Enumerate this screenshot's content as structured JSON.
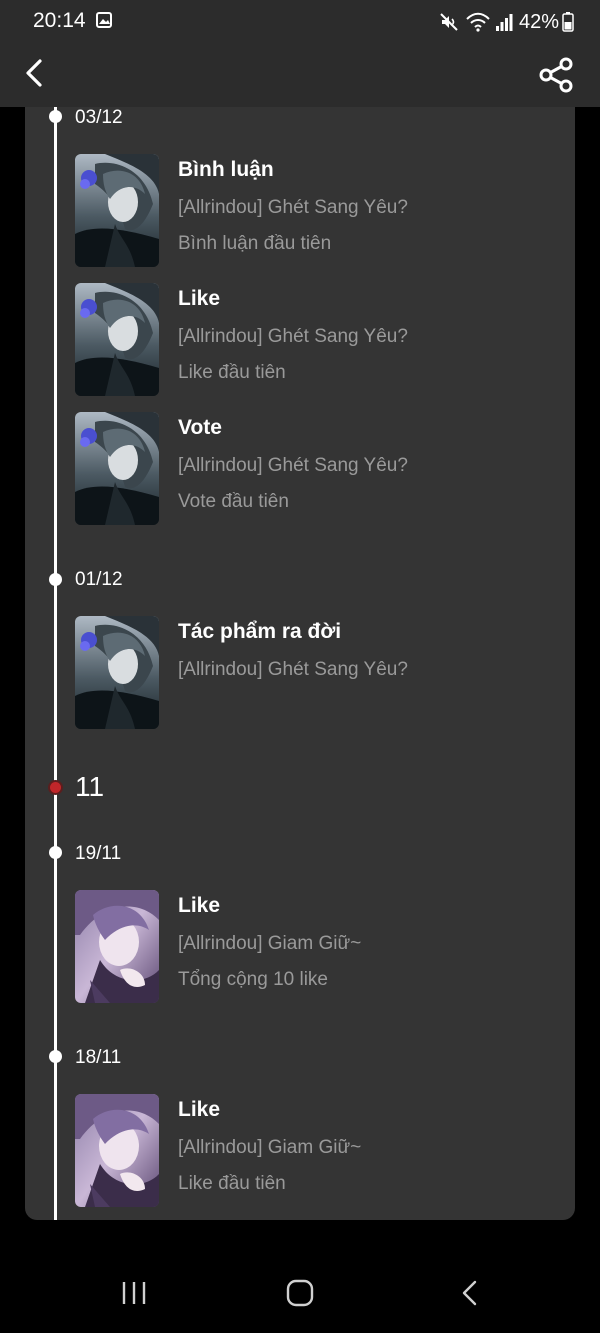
{
  "status_bar": {
    "time": "20:14",
    "battery": "42%",
    "icons": [
      "gallery-icon",
      "mute-icon",
      "wifi-icon",
      "signal-icon",
      "battery-icon"
    ]
  },
  "app_bar": {
    "icons": [
      "back-arrow-icon",
      "share-icon"
    ]
  },
  "timeline": {
    "groups": [
      {
        "date": "03/12",
        "entries": [
          {
            "title": "Bình luận",
            "story": "[Allrindou] Ghét Sang Yêu?",
            "desc": "Bình luận đầu tiên",
            "cover": "dark-anime-cover"
          },
          {
            "title": "Like",
            "story": "[Allrindou] Ghét Sang Yêu?",
            "desc": "Like đầu tiên",
            "cover": "dark-anime-cover"
          },
          {
            "title": "Vote",
            "story": "[Allrindou] Ghét Sang Yêu?",
            "desc": "Vote đầu tiên",
            "cover": "dark-anime-cover"
          }
        ]
      },
      {
        "date": "01/12",
        "entries": [
          {
            "title": "Tác phẩm ra đời",
            "story": "[Allrindou] Ghét Sang Yêu?",
            "desc": "",
            "cover": "dark-anime-cover"
          }
        ]
      }
    ],
    "month_marker": "11",
    "groups_after_marker": [
      {
        "date": "19/11",
        "entries": [
          {
            "title": "Like",
            "story": "[Allrindou] Giam Giữ~",
            "desc": "Tổng cộng 10 like",
            "cover": "purple-anime-cover"
          }
        ]
      },
      {
        "date": "18/11",
        "entries": [
          {
            "title": "Like",
            "story": "[Allrindou] Giam Giữ~",
            "desc": "Like đầu tiên",
            "cover": "purple-anime-cover"
          }
        ]
      }
    ]
  },
  "nav_bar": {
    "icons": [
      "recent-apps-icon",
      "home-icon",
      "back-icon"
    ]
  },
  "colors": {
    "app_bar_bg": "#2c2c2c",
    "card_bg": "#343434",
    "secondary_text": "#9a9a9a",
    "month_dot": "#c0262a"
  }
}
